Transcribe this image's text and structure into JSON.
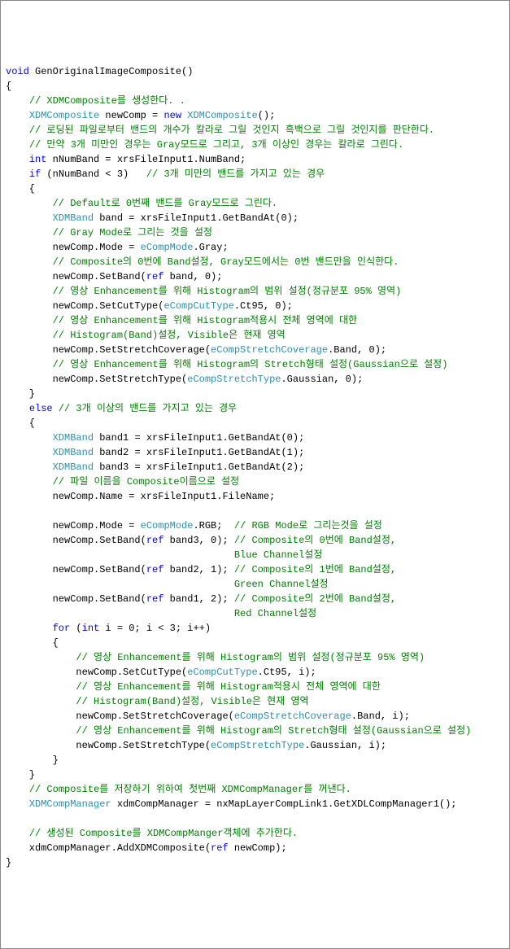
{
  "lines": [
    {
      "segments": [
        {
          "c": "kw",
          "t": "void"
        },
        {
          "c": "txt",
          "t": " GenOriginalImageComposite()"
        }
      ]
    },
    {
      "segments": [
        {
          "c": "txt",
          "t": "{"
        }
      ]
    },
    {
      "segments": [
        {
          "c": "txt",
          "t": "    "
        },
        {
          "c": "comment",
          "t": "// XDMComposite를 생성한다. ."
        }
      ]
    },
    {
      "segments": [
        {
          "c": "txt",
          "t": "    "
        },
        {
          "c": "type",
          "t": "XDMComposite"
        },
        {
          "c": "txt",
          "t": " newComp = "
        },
        {
          "c": "kw",
          "t": "new"
        },
        {
          "c": "txt",
          "t": " "
        },
        {
          "c": "type",
          "t": "XDMComposite"
        },
        {
          "c": "txt",
          "t": "();"
        }
      ]
    },
    {
      "segments": [
        {
          "c": "txt",
          "t": "    "
        },
        {
          "c": "comment",
          "t": "// 로딩된 파일로부터 밴드의 개수가 칼라로 그릴 것인지 흑백으로 그릴 것인지를 판단한다."
        }
      ]
    },
    {
      "segments": [
        {
          "c": "txt",
          "t": "    "
        },
        {
          "c": "comment",
          "t": "// 만약 3개 미만인 경우는 Gray모드로 그리고, 3개 이상인 경우는 칼라로 그린다."
        }
      ]
    },
    {
      "segments": [
        {
          "c": "txt",
          "t": "    "
        },
        {
          "c": "kw",
          "t": "int"
        },
        {
          "c": "txt",
          "t": " nNumBand = xrsFileInput1.NumBand;"
        }
      ]
    },
    {
      "segments": [
        {
          "c": "txt",
          "t": "    "
        },
        {
          "c": "kw",
          "t": "if"
        },
        {
          "c": "txt",
          "t": " (nNumBand < 3)   "
        },
        {
          "c": "comment",
          "t": "// 3개 미만의 밴드를 가지고 있는 경우"
        }
      ]
    },
    {
      "segments": [
        {
          "c": "txt",
          "t": "    {"
        }
      ]
    },
    {
      "segments": [
        {
          "c": "txt",
          "t": "        "
        },
        {
          "c": "comment",
          "t": "// Default로 0번째 밴드를 Gray모드로 그린다."
        }
      ]
    },
    {
      "segments": [
        {
          "c": "txt",
          "t": "        "
        },
        {
          "c": "type",
          "t": "XDMBand"
        },
        {
          "c": "txt",
          "t": " band = xrsFileInput1.GetBandAt(0);"
        }
      ]
    },
    {
      "segments": [
        {
          "c": "txt",
          "t": "        "
        },
        {
          "c": "comment",
          "t": "// Gray Mode로 그리는 것을 설정"
        }
      ]
    },
    {
      "segments": [
        {
          "c": "txt",
          "t": "        newComp.Mode = "
        },
        {
          "c": "enum",
          "t": "eCompMode"
        },
        {
          "c": "txt",
          "t": ".Gray;"
        }
      ]
    },
    {
      "segments": [
        {
          "c": "txt",
          "t": "        "
        },
        {
          "c": "comment",
          "t": "// Composite의 0번에 Band설정, Gray모드에서는 0번 밴드만을 인식한다."
        }
      ]
    },
    {
      "segments": [
        {
          "c": "txt",
          "t": "        newComp.SetBand("
        },
        {
          "c": "kw",
          "t": "ref"
        },
        {
          "c": "txt",
          "t": " band, 0);"
        }
      ]
    },
    {
      "segments": [
        {
          "c": "txt",
          "t": "        "
        },
        {
          "c": "comment",
          "t": "// 영상 Enhancement를 위해 Histogram의 범위 설정(정규분포 95% 영역)"
        }
      ]
    },
    {
      "segments": [
        {
          "c": "txt",
          "t": "        newComp.SetCutType("
        },
        {
          "c": "enum",
          "t": "eCompCutType"
        },
        {
          "c": "txt",
          "t": ".Ct95, 0);"
        }
      ]
    },
    {
      "segments": [
        {
          "c": "txt",
          "t": "        "
        },
        {
          "c": "comment",
          "t": "// 영상 Enhancement를 위해 Histogram적용시 전체 영역에 대한"
        }
      ]
    },
    {
      "segments": [
        {
          "c": "txt",
          "t": "        "
        },
        {
          "c": "comment",
          "t": "// Histogram(Band)설정, Visible은 현재 영역"
        }
      ]
    },
    {
      "segments": [
        {
          "c": "txt",
          "t": "        newComp.SetStretchCoverage("
        },
        {
          "c": "enum",
          "t": "eCompStretchCoverage"
        },
        {
          "c": "txt",
          "t": ".Band, 0);"
        }
      ]
    },
    {
      "segments": [
        {
          "c": "txt",
          "t": "        "
        },
        {
          "c": "comment",
          "t": "// 영상 Enhancement를 위해 Histogram의 Stretch형태 설정(Gaussian으로 설정)"
        }
      ]
    },
    {
      "segments": [
        {
          "c": "txt",
          "t": "        newComp.SetStretchType("
        },
        {
          "c": "enum",
          "t": "eCompStretchType"
        },
        {
          "c": "txt",
          "t": ".Gaussian, 0);"
        }
      ]
    },
    {
      "segments": [
        {
          "c": "txt",
          "t": "    }"
        }
      ]
    },
    {
      "segments": [
        {
          "c": "txt",
          "t": "    "
        },
        {
          "c": "kw",
          "t": "else"
        },
        {
          "c": "txt",
          "t": " "
        },
        {
          "c": "comment",
          "t": "// 3개 이상의 밴드를 가지고 있는 경우"
        }
      ]
    },
    {
      "segments": [
        {
          "c": "txt",
          "t": "    {"
        }
      ]
    },
    {
      "segments": [
        {
          "c": "txt",
          "t": "        "
        },
        {
          "c": "type",
          "t": "XDMBand"
        },
        {
          "c": "txt",
          "t": " band1 = xrsFileInput1.GetBandAt(0);"
        }
      ]
    },
    {
      "segments": [
        {
          "c": "txt",
          "t": "        "
        },
        {
          "c": "type",
          "t": "XDMBand"
        },
        {
          "c": "txt",
          "t": " band2 = xrsFileInput1.GetBandAt(1);"
        }
      ]
    },
    {
      "segments": [
        {
          "c": "txt",
          "t": "        "
        },
        {
          "c": "type",
          "t": "XDMBand"
        },
        {
          "c": "txt",
          "t": " band3 = xrsFileInput1.GetBandAt(2);"
        }
      ]
    },
    {
      "segments": [
        {
          "c": "txt",
          "t": "        "
        },
        {
          "c": "comment",
          "t": "// 파일 이름을 Composite이름으로 설정"
        }
      ]
    },
    {
      "segments": [
        {
          "c": "txt",
          "t": "        newComp.Name = xrsFileInput1.FileName;"
        }
      ]
    },
    {
      "segments": [
        {
          "c": "txt",
          "t": ""
        }
      ]
    },
    {
      "segments": [
        {
          "c": "txt",
          "t": "        newComp.Mode = "
        },
        {
          "c": "enum",
          "t": "eCompMode"
        },
        {
          "c": "txt",
          "t": ".RGB;  "
        },
        {
          "c": "comment",
          "t": "// RGB Mode로 그리는것을 설정"
        }
      ]
    },
    {
      "segments": [
        {
          "c": "txt",
          "t": "        newComp.SetBand("
        },
        {
          "c": "kw",
          "t": "ref"
        },
        {
          "c": "txt",
          "t": " band3, 0); "
        },
        {
          "c": "comment",
          "t": "// Composite의 0번에 Band설정,"
        }
      ]
    },
    {
      "segments": [
        {
          "c": "txt",
          "t": "                                       "
        },
        {
          "c": "comment",
          "t": "Blue Channel설정"
        }
      ]
    },
    {
      "segments": [
        {
          "c": "txt",
          "t": "        newComp.SetBand("
        },
        {
          "c": "kw",
          "t": "ref"
        },
        {
          "c": "txt",
          "t": " band2, 1); "
        },
        {
          "c": "comment",
          "t": "// Composite의 1번에 Band설정,"
        }
      ]
    },
    {
      "segments": [
        {
          "c": "txt",
          "t": "                                       "
        },
        {
          "c": "comment",
          "t": "Green Channel설정"
        }
      ]
    },
    {
      "segments": [
        {
          "c": "txt",
          "t": "        newComp.SetBand("
        },
        {
          "c": "kw",
          "t": "ref"
        },
        {
          "c": "txt",
          "t": " band1, 2); "
        },
        {
          "c": "comment",
          "t": "// Composite의 2번에 Band설정,"
        }
      ]
    },
    {
      "segments": [
        {
          "c": "txt",
          "t": "                                       "
        },
        {
          "c": "comment",
          "t": "Red Channel설정"
        }
      ]
    },
    {
      "segments": [
        {
          "c": "txt",
          "t": "        "
        },
        {
          "c": "kw",
          "t": "for"
        },
        {
          "c": "txt",
          "t": " ("
        },
        {
          "c": "kw",
          "t": "int"
        },
        {
          "c": "txt",
          "t": " i = 0; i < 3; i++)"
        }
      ]
    },
    {
      "segments": [
        {
          "c": "txt",
          "t": "        {"
        }
      ]
    },
    {
      "segments": [
        {
          "c": "txt",
          "t": "            "
        },
        {
          "c": "comment",
          "t": "// 영상 Enhancement를 위해 Histogram의 범위 설정(정규분포 95% 영역)"
        }
      ]
    },
    {
      "segments": [
        {
          "c": "txt",
          "t": "            newComp.SetCutType("
        },
        {
          "c": "enum",
          "t": "eCompCutType"
        },
        {
          "c": "txt",
          "t": ".Ct95, i);"
        }
      ]
    },
    {
      "segments": [
        {
          "c": "txt",
          "t": "            "
        },
        {
          "c": "comment",
          "t": "// 영상 Enhancement를 위해 Histogram적용시 전체 영역에 대한"
        }
      ]
    },
    {
      "segments": [
        {
          "c": "txt",
          "t": "            "
        },
        {
          "c": "comment",
          "t": "// Histogram(Band)설정, Visible은 현재 영역"
        }
      ]
    },
    {
      "segments": [
        {
          "c": "txt",
          "t": "            newComp.SetStretchCoverage("
        },
        {
          "c": "enum",
          "t": "eCompStretchCoverage"
        },
        {
          "c": "txt",
          "t": ".Band, i);"
        }
      ]
    },
    {
      "segments": [
        {
          "c": "txt",
          "t": "            "
        },
        {
          "c": "comment",
          "t": "// 영상 Enhancement를 위해 Histogram의 Stretch형태 설정(Gaussian으로 설정)"
        }
      ]
    },
    {
      "segments": [
        {
          "c": "txt",
          "t": "            newComp.SetStretchType("
        },
        {
          "c": "enum",
          "t": "eCompStretchType"
        },
        {
          "c": "txt",
          "t": ".Gaussian, i);"
        }
      ]
    },
    {
      "segments": [
        {
          "c": "txt",
          "t": "        }"
        }
      ]
    },
    {
      "segments": [
        {
          "c": "txt",
          "t": "    }"
        }
      ]
    },
    {
      "segments": [
        {
          "c": "txt",
          "t": "    "
        },
        {
          "c": "comment",
          "t": "// Composite를 저장하기 위하여 첫번째 XDMCompManager를 꺼낸다."
        }
      ]
    },
    {
      "segments": [
        {
          "c": "txt",
          "t": "    "
        },
        {
          "c": "type",
          "t": "XDMCompManager"
        },
        {
          "c": "txt",
          "t": " xdmCompManager = nxMapLayerCompLink1.GetXDLCompManager1();"
        }
      ]
    },
    {
      "segments": [
        {
          "c": "txt",
          "t": ""
        }
      ]
    },
    {
      "segments": [
        {
          "c": "txt",
          "t": "    "
        },
        {
          "c": "comment",
          "t": "// 생성된 Composite를 XDMCompManger객체에 추가한다."
        }
      ]
    },
    {
      "segments": [
        {
          "c": "txt",
          "t": "    xdmCompManager.AddXDMComposite("
        },
        {
          "c": "kw",
          "t": "ref"
        },
        {
          "c": "txt",
          "t": " newComp);"
        }
      ]
    },
    {
      "segments": [
        {
          "c": "txt",
          "t": "}"
        }
      ]
    }
  ]
}
